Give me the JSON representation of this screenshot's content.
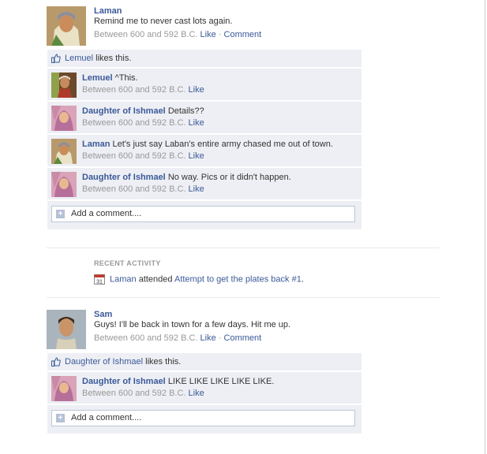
{
  "story1": {
    "author": "Laman",
    "message": "Remind me to never cast lots again.",
    "time": "Between 600 and 592 B.C.",
    "like_link": "Like",
    "separator": "·",
    "comment_link": "Comment",
    "likes": {
      "name": "Lemuel",
      "suffix": "likes this."
    },
    "comments": [
      {
        "author": "Lemuel",
        "text": "^This.",
        "time": "Between 600 and 592 B.C.",
        "like": "Like"
      },
      {
        "author": "Daughter of Ishmael",
        "text": "Details??",
        "time": "Between 600 and 592 B.C.",
        "like": "Like"
      },
      {
        "author": "Laman",
        "text": "Let's just say Laban's entire army chased me out of town.",
        "time": "Between 600 and 592 B.C.",
        "like": "Like"
      },
      {
        "author": "Daughter of Ishmael",
        "text": "No way. Pics or it didn't happen.",
        "time": "Between 600 and 592 B.C.",
        "like": "Like"
      }
    ],
    "add_comment": "Add a comment...."
  },
  "recent": {
    "title": "RECENT ACTIVITY",
    "actor": "Laman",
    "verb": "attended",
    "event": "Attempt to get the plates back #1",
    "end": ".",
    "calendar_day": "31"
  },
  "story2": {
    "author": "Sam",
    "message": "Guys! I'll be back in town for a few days. Hit me up.",
    "time": "Between 600 and 592 B.C.",
    "like_link": "Like",
    "separator": "·",
    "comment_link": "Comment",
    "likes": {
      "name": "Daughter of Ishmael",
      "suffix": "likes this."
    },
    "comments": [
      {
        "author": "Daughter of Ishmael",
        "text": "LIKE LIKE LIKE LIKE LIKE.",
        "time": "Between 600 and 592 B.C.",
        "like": "Like"
      }
    ],
    "add_comment": "Add a comment...."
  },
  "colors": {
    "link": "#3b5998",
    "muted": "#999999",
    "ufi_bg": "#edeff4"
  }
}
